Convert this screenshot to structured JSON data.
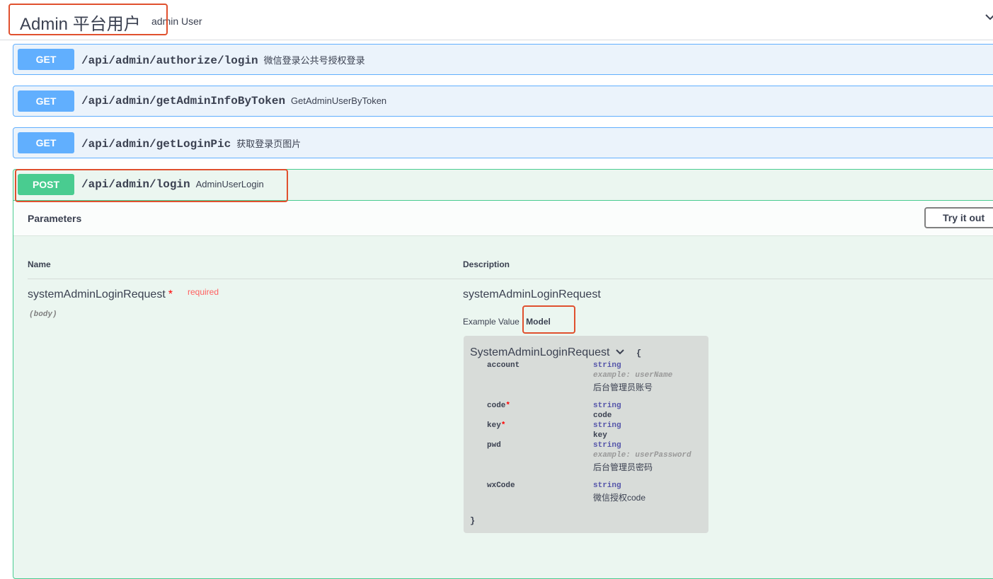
{
  "tag": {
    "title": "Admin 平台用户",
    "description": "admin User",
    "chevron_icon": "chevron-down-icon"
  },
  "operations": [
    {
      "method": "GET",
      "path": "/api/admin/authorize/login",
      "summary": "微信登录公共号授权登录"
    },
    {
      "method": "GET",
      "path": "/api/admin/getAdminInfoByToken",
      "summary": "GetAdminUserByToken"
    },
    {
      "method": "GET",
      "path": "/api/admin/getLoginPic",
      "summary": "获取登录页图片"
    },
    {
      "method": "POST",
      "path": "/api/admin/login",
      "summary": "AdminUserLogin"
    }
  ],
  "parameters": {
    "title": "Parameters",
    "try_button": "Try it out",
    "col_name": "Name",
    "col_description": "Description",
    "param": {
      "name": "systemAdminLoginRequest",
      "required_star": "*",
      "required_text": "required",
      "in": "(body)",
      "schema_name": "systemAdminLoginRequest",
      "tab_example": "Example Value",
      "tab_model": "Model"
    }
  },
  "model": {
    "title": "SystemAdminLoginRequest",
    "toggle_icon": "chevron-down-icon",
    "brace_open": "{",
    "brace_close": "}",
    "props": [
      {
        "name": "account",
        "required": "",
        "type": "string",
        "example": "example: userName",
        "desc": "后台管理员账号"
      },
      {
        "name": "code",
        "required": "*",
        "type": "string",
        "example": "",
        "desc": "code"
      },
      {
        "name": "key",
        "required": "*",
        "type": "string",
        "example": "",
        "desc": "key"
      },
      {
        "name": "pwd",
        "required": "",
        "type": "string",
        "example": "example: userPassword",
        "desc": "后台管理员密码"
      },
      {
        "name": "wxCode",
        "required": "",
        "type": "string",
        "example": "",
        "desc": "微信授权code"
      }
    ]
  },
  "colors": {
    "get": "#61affe",
    "post": "#49cc90",
    "highlight": "#e0502e"
  }
}
